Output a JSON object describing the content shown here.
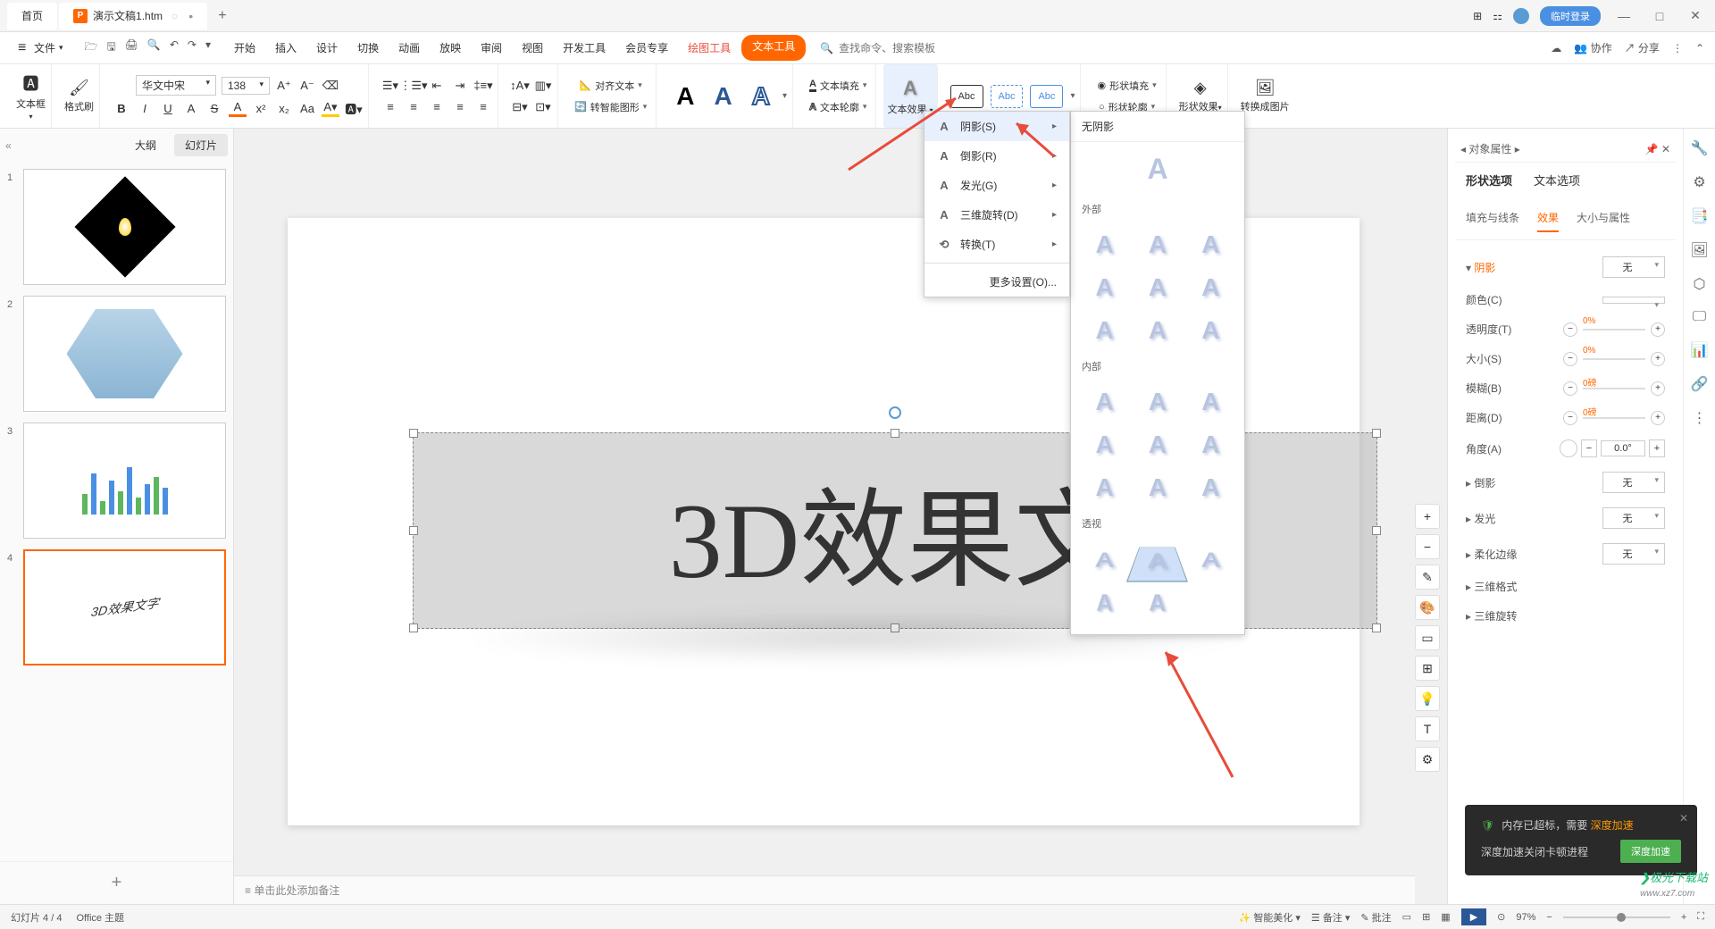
{
  "titlebar": {
    "home_tab": "首页",
    "doc_tab": "演示文稿1.htm",
    "login": "临时登录"
  },
  "menubar": {
    "file": "文件",
    "tabs": [
      "开始",
      "插入",
      "设计",
      "切换",
      "动画",
      "放映",
      "审阅",
      "视图",
      "开发工具",
      "会员专享"
    ],
    "drawing_tools": "绘图工具",
    "text_tools": "文本工具",
    "search_placeholder": "查找命令、搜索模板",
    "collab": "协作",
    "share": "分享"
  },
  "ribbon": {
    "textbox": "文本框",
    "format_painter": "格式刷",
    "font_name": "华文中宋",
    "font_size": "138",
    "text_fill": "文本填充",
    "text_outline": "文本轮廓",
    "text_effects": "文本效果",
    "align_text": "对齐文本",
    "convert_smart": "转智能图形",
    "shape_fill": "形状填充",
    "shape_outline": "形状轮廓",
    "shape_effects": "形状效果",
    "convert_image": "转换成图片",
    "abc": "Abc"
  },
  "dropdown1": {
    "shadow": "阴影(S)",
    "reflection": "倒影(R)",
    "glow": "发光(G)",
    "rotation3d": "三维旋转(D)",
    "transform": "转换(T)",
    "more_settings": "更多设置(O)..."
  },
  "dropdown2": {
    "no_shadow": "无阴影",
    "outer": "外部",
    "inner": "内部",
    "perspective": "透视"
  },
  "slides": {
    "outline": "大纲",
    "slides_tab": "幻灯片",
    "thumb4_text": "3D效果文字"
  },
  "canvas": {
    "main_text": "3D效果文"
  },
  "notes": "单击此处添加备注",
  "right_panel": {
    "title": "对象属性",
    "shape_options": "形状选项",
    "text_options": "文本选项",
    "fill_line": "填充与线条",
    "effects": "效果",
    "size_props": "大小与属性",
    "shadow": "阴影",
    "none": "无",
    "color": "颜色(C)",
    "transparency": "透明度(T)",
    "size": "大小(S)",
    "blur": "模糊(B)",
    "distance": "距离(D)",
    "angle": "角度(A)",
    "angle_val": "0.0°",
    "pct0": "0%",
    "pt0": "0磅",
    "reflection": "倒影",
    "glow": "发光",
    "soft_edges": "柔化边缘",
    "format_3d": "三维格式",
    "rotation_3d": "三维旋转"
  },
  "statusbar": {
    "slide_info": "幻灯片 4 / 4",
    "theme": "Office 主题",
    "smart_beautify": "智能美化",
    "backup": "备注",
    "annotate": "批注",
    "zoom": "97%"
  },
  "toast": {
    "title_prefix": "内存已超标，需要",
    "title_highlight": "深度加速",
    "body": "深度加速关闭卡顿进程",
    "button": "深度加速"
  },
  "watermark": {
    "brand": "极光下载站",
    "url": "www.xz7.com"
  }
}
